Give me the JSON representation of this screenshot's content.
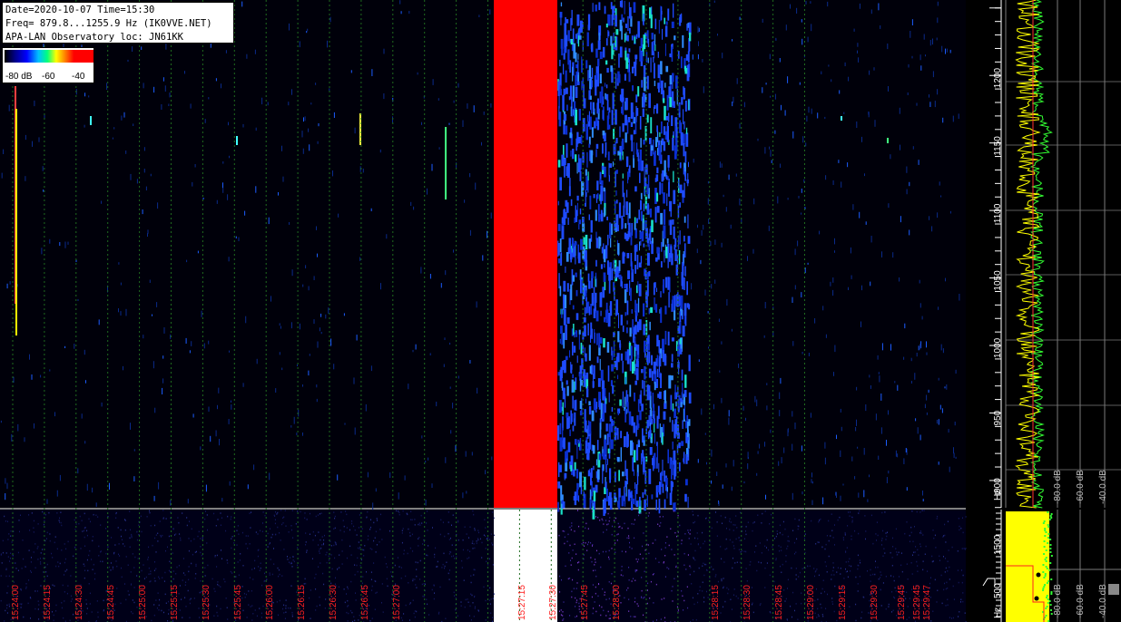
{
  "info": {
    "line1": "Date=2020-10-07 Time=15:30",
    "line2": "Freq= 879.8...1255.9 Hz (IK0VVE.NET)",
    "line3": "APA-LAN Observatory loc: JN61KK"
  },
  "legend": {
    "labels": [
      "-80 dB",
      "-60",
      "-40"
    ],
    "colors": [
      "#000000",
      "#0000ff",
      "#00ffff",
      "#00ff00",
      "#ffff00",
      "#ff0000"
    ]
  },
  "freq_axis": {
    "ticks": [
      "1200",
      "1150",
      "1100",
      "1050",
      "1000",
      "950",
      "900"
    ],
    "unit": "Hz"
  },
  "freq_axis_lower": {
    "ticks": [
      "1500",
      "500"
    ],
    "unit": "Hz"
  },
  "power_axis": {
    "labels": [
      "-80.0 dB",
      "-60.0 dB",
      "-40.0 dB"
    ]
  },
  "time_labels": [
    "15:24:00",
    "15:24:15",
    "15:24:30",
    "15:24:45",
    "15:25:00",
    "15:25:15",
    "15:25:30",
    "15:25:45",
    "15:26:00",
    "15:26:15",
    "15:26:30",
    "15:26:45",
    "15:27:00",
    "15:27:15",
    "15:27:30",
    "15:27:45",
    "15:28:00",
    "15:28:15",
    "15:28:30",
    "15:28:45",
    "15:29:00",
    "15:29:15",
    "15:29:30",
    "15:29:45",
    "15:29:45",
    "15:29:47"
  ],
  "colors": {
    "background": "#000000",
    "gridline": "#1f6b1f",
    "time_label": "#ff2020",
    "overload": "#ff0000",
    "noise_blue": "#1e4bff",
    "spectrum_yellow": "#ffff00",
    "spectrum_green": "#33ff33",
    "axis_grid": "#7a7a7a"
  }
}
